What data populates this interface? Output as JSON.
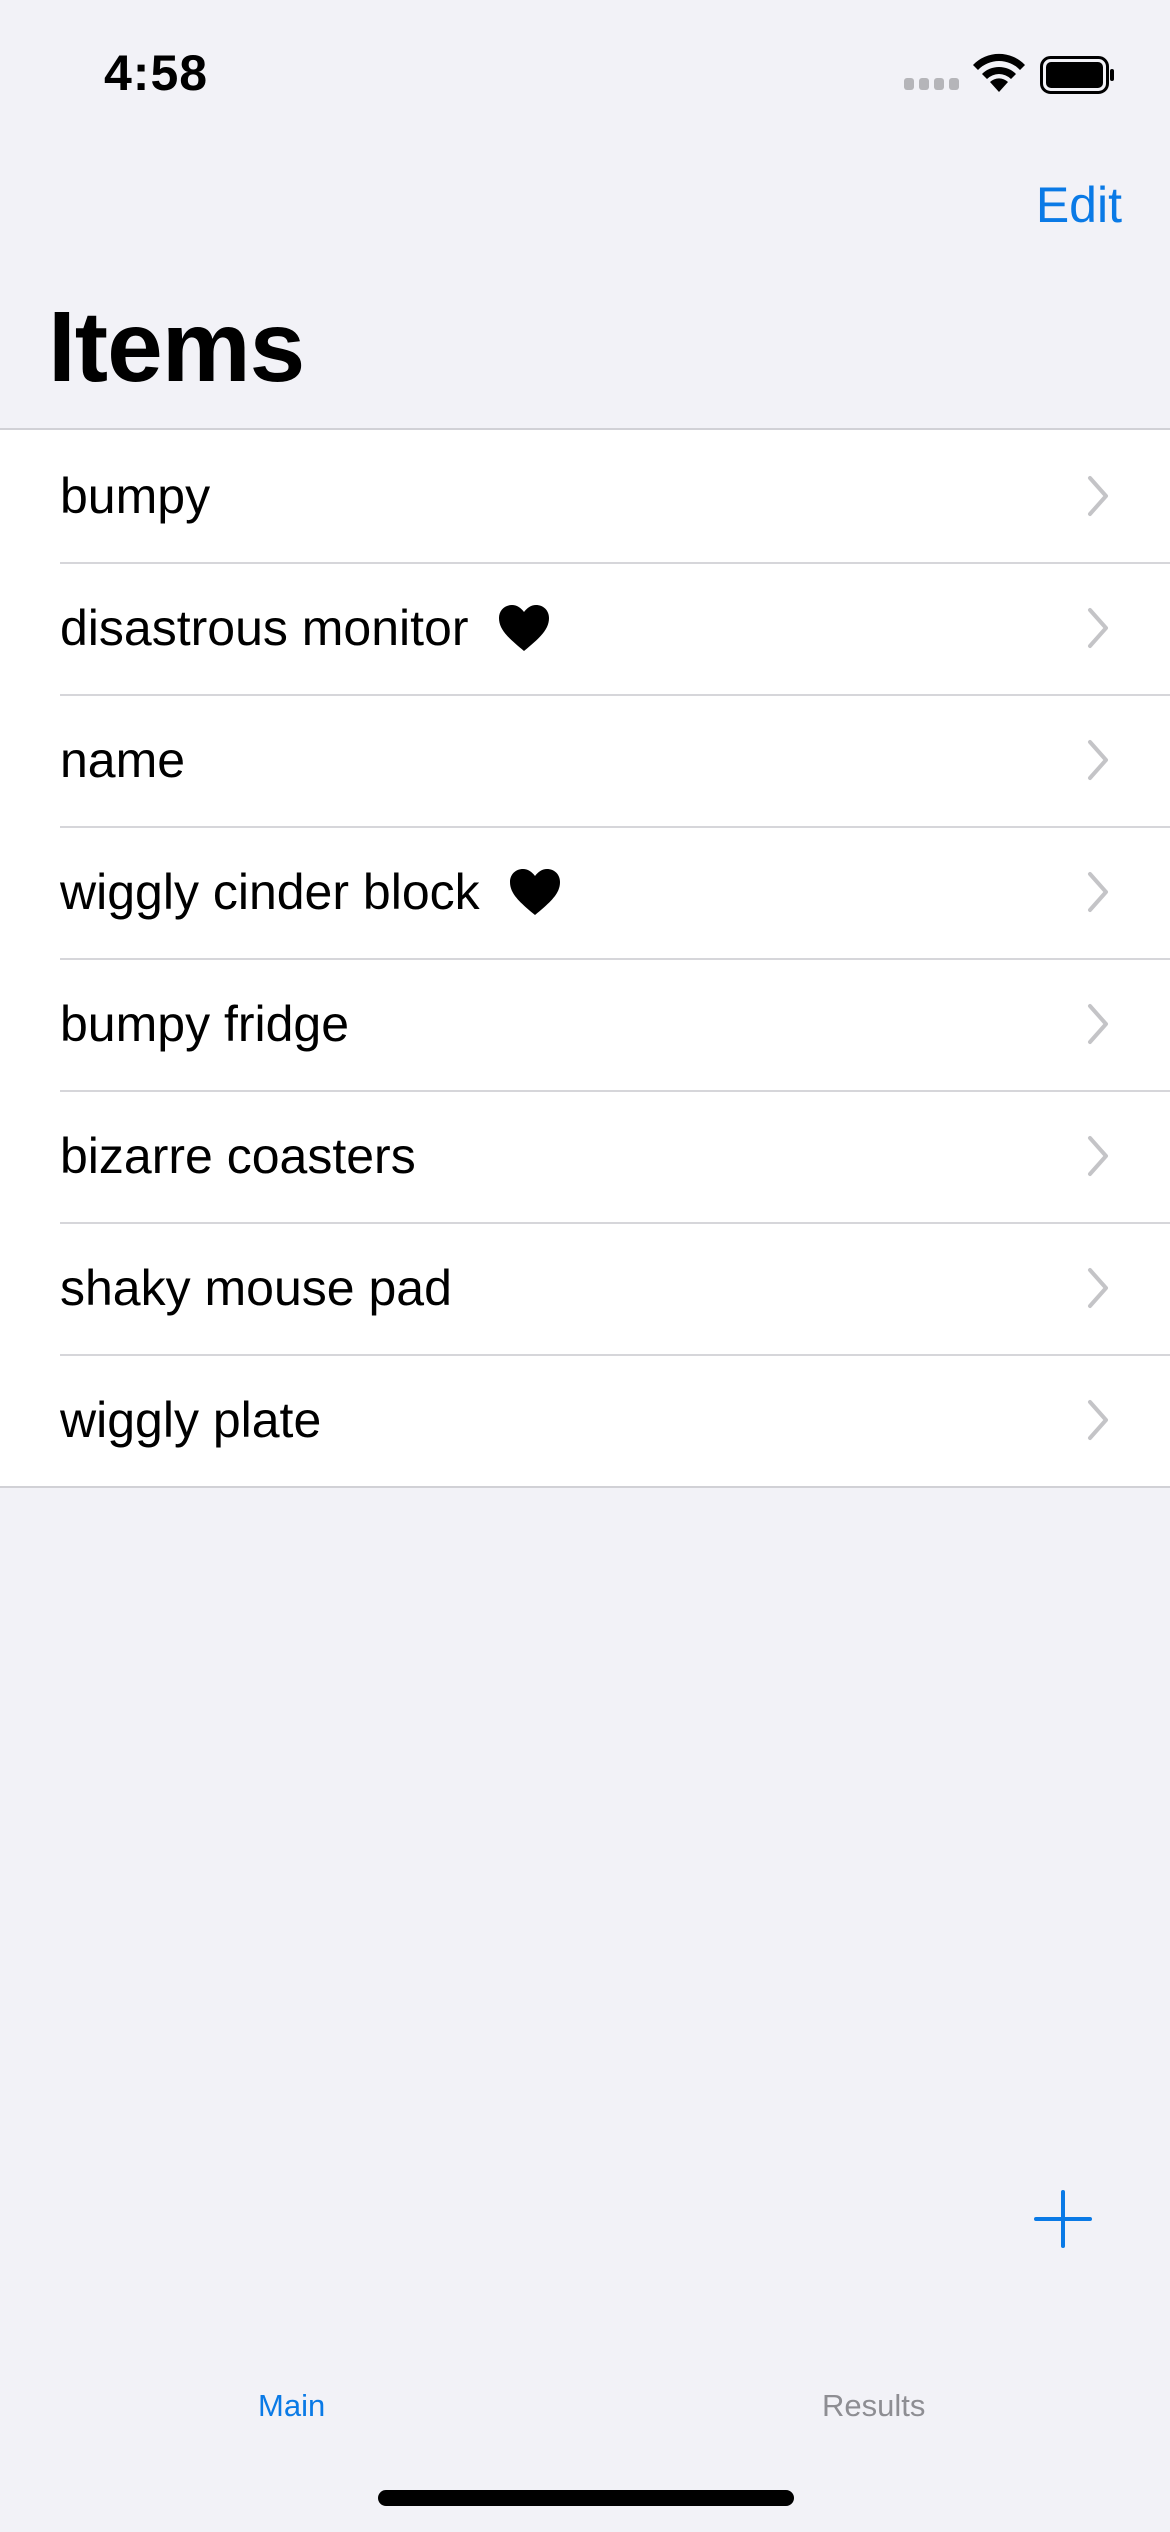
{
  "status_bar": {
    "time": "4:58",
    "icons": [
      "cellular-signal-icon",
      "wifi-icon",
      "battery-icon"
    ]
  },
  "nav": {
    "edit_label": "Edit",
    "title": "Items"
  },
  "items": [
    {
      "label": "bumpy",
      "favorite": false
    },
    {
      "label": "disastrous monitor",
      "favorite": true
    },
    {
      "label": "name",
      "favorite": false
    },
    {
      "label": "wiggly cinder block",
      "favorite": true
    },
    {
      "label": "bumpy fridge",
      "favorite": false
    },
    {
      "label": "bizarre coasters",
      "favorite": false
    },
    {
      "label": "shaky mouse pad",
      "favorite": false
    },
    {
      "label": "wiggly plate",
      "favorite": false
    }
  ],
  "add_button": {
    "icon": "plus-icon"
  },
  "tab_bar": {
    "tabs": [
      {
        "label": "Main",
        "selected": true
      },
      {
        "label": "Results",
        "selected": false
      }
    ]
  },
  "colors": {
    "accent": "#0a7ae6",
    "background": "#f2f2f7",
    "inactive_tab": "#8e8e93"
  }
}
